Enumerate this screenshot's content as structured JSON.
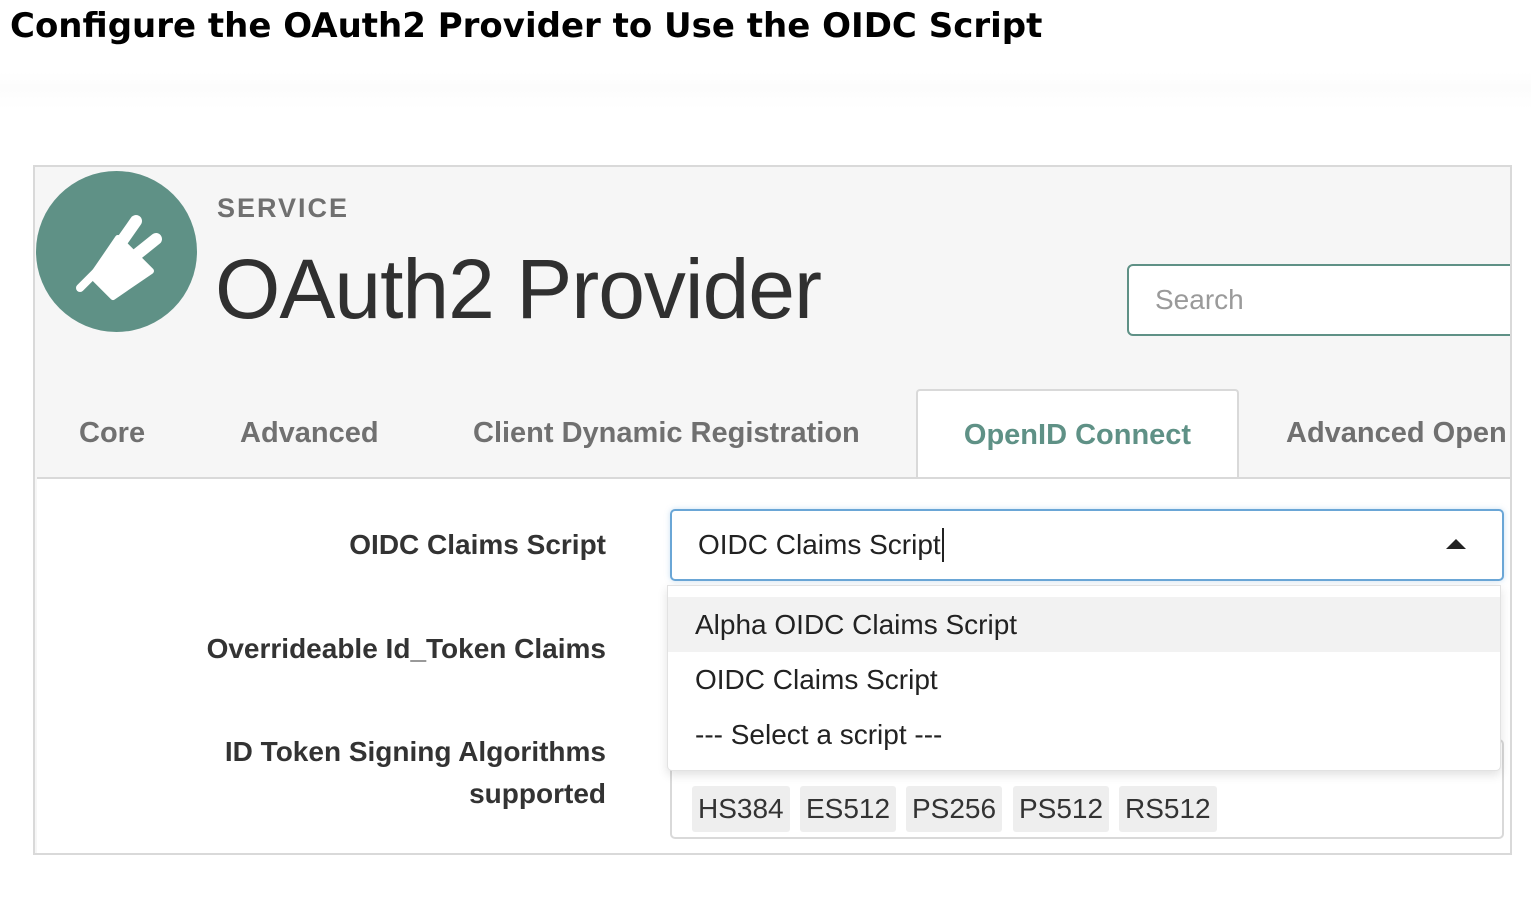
{
  "doc": {
    "title": "Configure the OAuth2 Provider to Use the OIDC Script"
  },
  "header": {
    "kicker": "SERVICE",
    "title": "OAuth2 Provider",
    "icon": "plug-icon",
    "icon_color": "#5f9186"
  },
  "search": {
    "placeholder": "Search",
    "value": ""
  },
  "tabs": [
    {
      "label": "Core"
    },
    {
      "label": "Advanced"
    },
    {
      "label": "Client Dynamic Registration"
    },
    {
      "label": "OpenID Connect",
      "active": true
    },
    {
      "label": "Advanced Open"
    }
  ],
  "form": {
    "oidc_claims_script": {
      "label": "OIDC Claims Script",
      "value": "OIDC Claims Script",
      "options": [
        "Alpha OIDC Claims Script",
        "OIDC Claims Script",
        "--- Select a script ---"
      ]
    },
    "overrideable_claims": {
      "label": "Overrideable Id_Token Claims"
    },
    "id_token_signing": {
      "label_line1": "ID Token Signing Algorithms",
      "label_line2": "supported",
      "values": [
        "HS384",
        "ES512",
        "PS256",
        "PS512",
        "RS512"
      ]
    }
  },
  "colors": {
    "accent": "#5f9186",
    "focus": "#6aa6d6"
  }
}
